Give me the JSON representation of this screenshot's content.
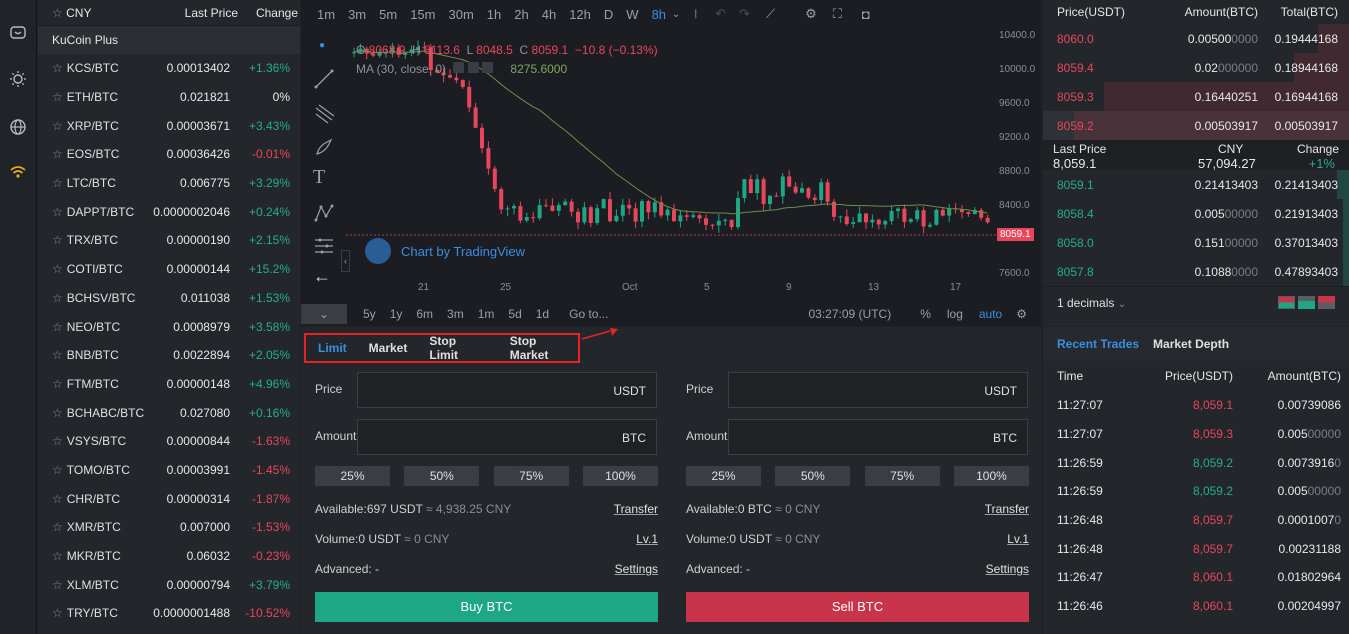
{
  "market": {
    "currency": "CNY",
    "col_last": "Last Price",
    "col_change": "Change",
    "section": "KuCoin Plus",
    "rows": [
      {
        "pair": "KCS/BTC",
        "price": "0.00013402",
        "change": "+1.36%",
        "dir": "up"
      },
      {
        "pair": "ETH/BTC",
        "price": "0.021821",
        "change": "0%",
        "dir": "neu"
      },
      {
        "pair": "XRP/BTC",
        "price": "0.00003671",
        "change": "+3.43%",
        "dir": "up"
      },
      {
        "pair": "EOS/BTC",
        "price": "0.00036426",
        "change": "-0.01%",
        "dir": "dn"
      },
      {
        "pair": "LTC/BTC",
        "price": "0.006775",
        "change": "+3.29%",
        "dir": "up"
      },
      {
        "pair": "DAPPT/BTC",
        "price": "0.0000002046",
        "change": "+0.24%",
        "dir": "up"
      },
      {
        "pair": "TRX/BTC",
        "price": "0.00000190",
        "change": "+2.15%",
        "dir": "up"
      },
      {
        "pair": "COTI/BTC",
        "price": "0.00000144",
        "change": "+15.2%",
        "dir": "up"
      },
      {
        "pair": "BCHSV/BTC",
        "price": "0.011038",
        "change": "+1.53%",
        "dir": "up"
      },
      {
        "pair": "NEO/BTC",
        "price": "0.0008979",
        "change": "+3.58%",
        "dir": "up"
      },
      {
        "pair": "BNB/BTC",
        "price": "0.0022894",
        "change": "+2.05%",
        "dir": "up"
      },
      {
        "pair": "FTM/BTC",
        "price": "0.00000148",
        "change": "+4.96%",
        "dir": "up"
      },
      {
        "pair": "BCHABC/BTC",
        "price": "0.027080",
        "change": "+0.16%",
        "dir": "up"
      },
      {
        "pair": "VSYS/BTC",
        "price": "0.00000844",
        "change": "-1.63%",
        "dir": "dn"
      },
      {
        "pair": "TOMO/BTC",
        "price": "0.00003991",
        "change": "-1.45%",
        "dir": "dn"
      },
      {
        "pair": "CHR/BTC",
        "price": "0.00000314",
        "change": "-1.87%",
        "dir": "dn"
      },
      {
        "pair": "XMR/BTC",
        "price": "0.007000",
        "change": "-1.53%",
        "dir": "dn"
      },
      {
        "pair": "MKR/BTC",
        "price": "0.06032",
        "change": "-0.23%",
        "dir": "dn"
      },
      {
        "pair": "XLM/BTC",
        "price": "0.00000794",
        "change": "+3.79%",
        "dir": "up"
      },
      {
        "pair": "TRY/BTC",
        "price": "0.0000001488",
        "change": "-10.52%",
        "dir": "dn"
      }
    ]
  },
  "chart": {
    "intervals": [
      "1m",
      "3m",
      "5m",
      "15m",
      "30m",
      "1h",
      "2h",
      "4h",
      "12h",
      "D",
      "W",
      "8h"
    ],
    "active_interval": "8h",
    "ohlc": {
      "o_label": "O",
      "o": "8068.9",
      "h_label": "H",
      "h": "8113.6",
      "l_label": "L",
      "l": "8048.5",
      "c_label": "C",
      "c": "8059.1",
      "chg": "−10.8 (−0.13%)"
    },
    "ma_label": "MA (30, close, 0)",
    "ma_value": "8275.6000",
    "watermark": "Chart by TradingView",
    "y_ticks": [
      "10400.0",
      "10000.0",
      "9600.0",
      "9200.0",
      "8800.0",
      "8400.0",
      "8059.1",
      "7600.0"
    ],
    "x_ticks": [
      "21",
      "25",
      "Oct",
      "5",
      "9",
      "13",
      "17"
    ],
    "ranges": [
      "5y",
      "1y",
      "6m",
      "3m",
      "1m",
      "5d",
      "1d",
      "Go to..."
    ],
    "clock": "03:27:09 (UTC)",
    "opts": [
      "%",
      "log",
      "auto"
    ],
    "price_tag": "8059.1"
  },
  "orders": {
    "tabs": [
      "Limit",
      "Market",
      "Stop Limit",
      "Stop Market"
    ],
    "price_label": "Price",
    "amount_label": "Amount",
    "unit_quote": "USDT",
    "unit_base": "BTC",
    "pcts": [
      "25%",
      "50%",
      "75%",
      "100%"
    ],
    "buy": {
      "available": "Available:697 USDT",
      "available_cny": "≈ 4,938.25 CNY",
      "transfer": "Transfer",
      "volume": "Volume:0 USDT",
      "volume_cny": "≈ 0 CNY",
      "level": "Lv.1",
      "advanced": "Advanced: -",
      "settings": "Settings",
      "button": "Buy BTC"
    },
    "sell": {
      "available": "Available:0 BTC",
      "available_cny": "≈ 0 CNY",
      "transfer": "Transfer",
      "volume": "Volume:0 USDT",
      "volume_cny": "≈ 0 CNY",
      "level": "Lv.1",
      "advanced": "Advanced: -",
      "settings": "Settings",
      "button": "Sell BTC"
    }
  },
  "book": {
    "h_price": "Price(USDT)",
    "h_amount": "Amount(BTC)",
    "h_total": "Total(BTC)",
    "asks": [
      {
        "price": "8060.0",
        "amt": "0.00500",
        "amt_dim": "0000",
        "total": "0.19444168",
        "depth": 0.1
      },
      {
        "price": "8059.4",
        "amt": "0.02",
        "amt_dim": "000000",
        "total": "0.18944168",
        "depth": 0.18
      },
      {
        "price": "8059.3",
        "amt": "0.16440251",
        "amt_dim": "",
        "total": "0.16944168",
        "depth": 0.8
      },
      {
        "price": "8059.2",
        "amt": "0.00503917",
        "amt_dim": "",
        "total": "0.00503917",
        "depth": 0.9
      }
    ],
    "last_label": "Last Price",
    "cny_label": "CNY",
    "change_label": "Change",
    "last_price": "8,059.1",
    "cny_price": "57,094.27",
    "change": "+1%",
    "bids": [
      {
        "price": "8059.1",
        "amt": "0.21413403",
        "amt_dim": "",
        "total": "0.21413403",
        "depth": 0.04
      },
      {
        "price": "8058.4",
        "amt": "0.005",
        "amt_dim": "00000",
        "total": "0.21913403",
        "depth": 0.02
      },
      {
        "price": "8058.0",
        "amt": "0.151",
        "amt_dim": "00000",
        "total": "0.37013403",
        "depth": 0.02
      },
      {
        "price": "8057.8",
        "amt": "0.1088",
        "amt_dim": "0000",
        "total": "0.47893403",
        "depth": 0.02
      }
    ],
    "decimals": "1 decimals"
  },
  "trades": {
    "tabs": [
      "Recent Trades",
      "Market Depth"
    ],
    "h_time": "Time",
    "h_price": "Price(USDT)",
    "h_amount": "Amount(BTC)",
    "rows": [
      {
        "time": "11:27:07",
        "price": "8,059.1",
        "dir": "dn",
        "amt": "0.00739086",
        "dim": ""
      },
      {
        "time": "11:27:07",
        "price": "8,059.3",
        "dir": "dn",
        "amt": "0.005",
        "dim": "00000"
      },
      {
        "time": "11:26:59",
        "price": "8,059.2",
        "dir": "up",
        "amt": "0.0073916",
        "dim": "0"
      },
      {
        "time": "11:26:59",
        "price": "8,059.2",
        "dir": "up",
        "amt": "0.005",
        "dim": "00000"
      },
      {
        "time": "11:26:48",
        "price": "8,059.7",
        "dir": "dn",
        "amt": "0.0001007",
        "dim": "0"
      },
      {
        "time": "11:26:48",
        "price": "8,059.7",
        "dir": "dn",
        "amt": "0.00231188",
        "dim": ""
      },
      {
        "time": "11:26:47",
        "price": "8,060.1",
        "dir": "dn",
        "amt": "0.01802964",
        "dim": ""
      },
      {
        "time": "11:26:46",
        "price": "8,060.1",
        "dir": "dn",
        "amt": "0.00204997",
        "dim": ""
      }
    ]
  }
}
